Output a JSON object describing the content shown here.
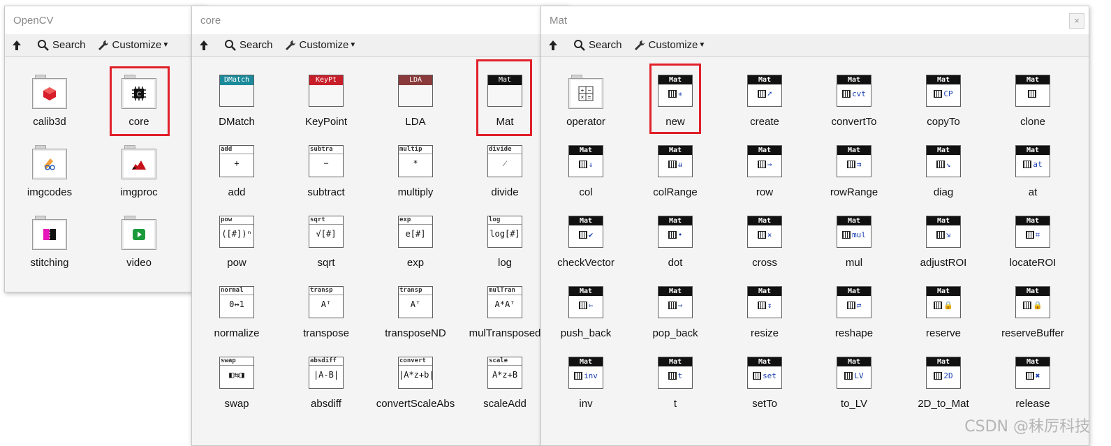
{
  "toolbar": {
    "search": "Search",
    "customize": "Customize"
  },
  "opencv": {
    "title": "OpenCV",
    "items": [
      "calib3d",
      "core",
      "imgcodes",
      "imgproc",
      "stitching",
      "video"
    ]
  },
  "core": {
    "title": "core",
    "items": [
      {
        "label": "DMatch",
        "hdr": "DMatch"
      },
      {
        "label": "KeyPoint",
        "hdr": "KeyPt"
      },
      {
        "label": "LDA",
        "hdr": "LDA"
      },
      {
        "label": "Mat",
        "hdr": "Mat"
      },
      {
        "label": "add",
        "hdr": "add",
        "glyph": "+"
      },
      {
        "label": "subtract",
        "hdr": "subtra",
        "glyph": "−"
      },
      {
        "label": "multiply",
        "hdr": "multip",
        "glyph": "*"
      },
      {
        "label": "divide",
        "hdr": "divide",
        "glyph": "⁄"
      },
      {
        "label": "pow",
        "hdr": "pow",
        "glyph": "([#])ⁿ"
      },
      {
        "label": "sqrt",
        "hdr": "sqrt",
        "glyph": "√[#]"
      },
      {
        "label": "exp",
        "hdr": "exp",
        "glyph": "e[#]"
      },
      {
        "label": "log",
        "hdr": "log",
        "glyph": "log[#]"
      },
      {
        "label": "normalize",
        "hdr": "normal",
        "glyph": "0↔1"
      },
      {
        "label": "transpose",
        "hdr": "transp",
        "glyph": "Aᵀ"
      },
      {
        "label": "transposeND",
        "hdr": "transp",
        "glyph": "Aᵀ"
      },
      {
        "label": "mulTransposed",
        "hdr": "mulTran",
        "glyph": "A*Aᵀ"
      },
      {
        "label": "swap",
        "hdr": "swap",
        "glyph": "◧⇆◨"
      },
      {
        "label": "absdiff",
        "hdr": "absdiff",
        "glyph": "|A-B|"
      },
      {
        "label": "convertScaleAbs",
        "hdr": "convert",
        "glyph": "|A*z+b|"
      },
      {
        "label": "scaleAdd",
        "hdr": "scale",
        "glyph": "A*z+B"
      }
    ]
  },
  "mat": {
    "title": "Mat",
    "hdr": "Mat",
    "close": "×",
    "items": [
      {
        "label": "operator"
      },
      {
        "label": "new",
        "glyph": "✳"
      },
      {
        "label": "create",
        "glyph": "➚"
      },
      {
        "label": "convertTo",
        "glyph": "cvt"
      },
      {
        "label": "copyTo",
        "glyph": "CP"
      },
      {
        "label": "clone",
        "glyph": ""
      },
      {
        "label": "col",
        "glyph": "↓"
      },
      {
        "label": "colRange",
        "glyph": "⇊"
      },
      {
        "label": "row",
        "glyph": "→"
      },
      {
        "label": "rowRange",
        "glyph": "⇉"
      },
      {
        "label": "diag",
        "glyph": "↘"
      },
      {
        "label": "at",
        "glyph": "at"
      },
      {
        "label": "checkVector",
        "glyph": "✔"
      },
      {
        "label": "dot",
        "glyph": "•"
      },
      {
        "label": "cross",
        "glyph": "×"
      },
      {
        "label": "mul",
        "glyph": "mul"
      },
      {
        "label": "adjustROI",
        "glyph": "⇲"
      },
      {
        "label": "locateROI",
        "glyph": "⌗"
      },
      {
        "label": "push_back",
        "glyph": "⇐"
      },
      {
        "label": "pop_back",
        "glyph": "⇒"
      },
      {
        "label": "resize",
        "glyph": "↕"
      },
      {
        "label": "reshape",
        "glyph": "⇄"
      },
      {
        "label": "reserve",
        "glyph": "🔒"
      },
      {
        "label": "reserveBuffer",
        "glyph": "🔒"
      },
      {
        "label": "inv",
        "glyph": "inv"
      },
      {
        "label": "t",
        "glyph": "t"
      },
      {
        "label": "setTo",
        "glyph": "set"
      },
      {
        "label": "to_LV",
        "glyph": "LV"
      },
      {
        "label": "2D_to_Mat",
        "glyph": "2D"
      },
      {
        "label": "release",
        "glyph": "✖"
      }
    ]
  },
  "watermark": "CSDN @秣厉科技",
  "colors": {
    "highlight": "#e0202a"
  }
}
